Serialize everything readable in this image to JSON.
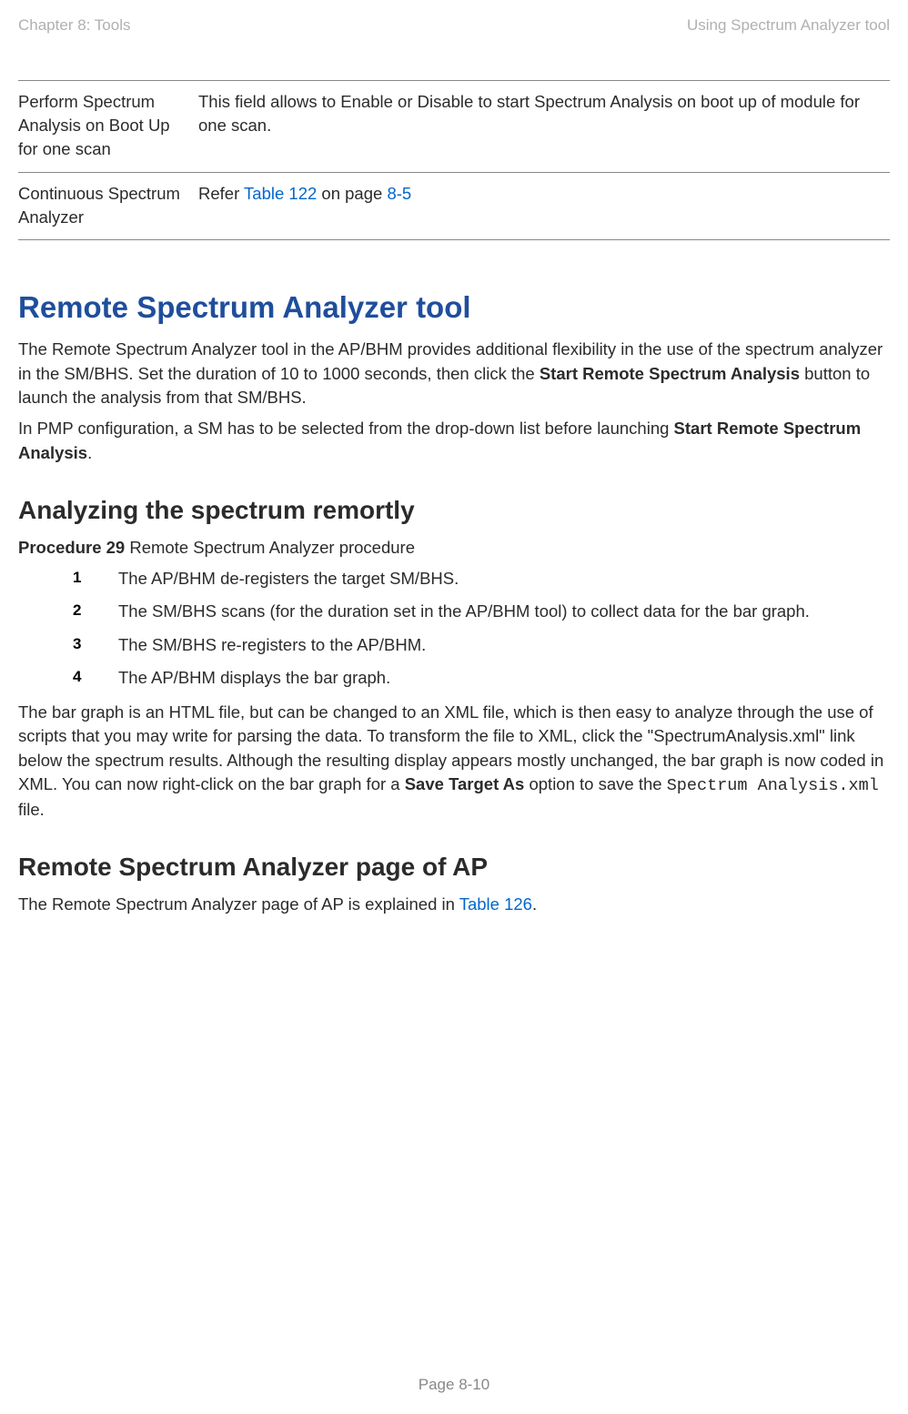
{
  "header": {
    "left": "Chapter 8:  Tools",
    "right": "Using Spectrum Analyzer tool"
  },
  "table": {
    "row1": {
      "left": "Perform Spectrum Analysis on Boot Up for one scan",
      "right": "This field allows to Enable or Disable to start Spectrum Analysis on boot up of module for one scan."
    },
    "row2": {
      "left": "Continuous Spectrum Analyzer",
      "right_prefix": "Refer ",
      "link1": "Table 122",
      "mid": " on page ",
      "link2": "8-5"
    }
  },
  "h1": "Remote Spectrum Analyzer tool",
  "para1_a": "The Remote Spectrum Analyzer tool in the AP/BHM provides additional flexibility in the use of the spectrum analyzer in the SM/BHS. Set the duration of 10 to 1000 seconds, then click the ",
  "para1_b": "Start Remote Spectrum Analysis",
  "para1_c": " button to launch the analysis from that SM/BHS.",
  "para2_a": "In PMP configuration, a SM has to be selected from the drop-down list before launching ",
  "para2_b": "Start Remote Spectrum Analysis",
  "para2_c": ".",
  "h2a": "Analyzing the spectrum remortly",
  "proc_label_a": "Procedure 29",
  "proc_label_b": "  Remote Spectrum Analyzer procedure",
  "steps": {
    "s1": "The AP/BHM de-registers the target SM/BHS.",
    "s2": "The SM/BHS scans (for the duration set in the AP/BHM tool) to collect data for the bar graph.",
    "s3": "The SM/BHS re-registers to the AP/BHM.",
    "s4": "The AP/BHM displays the bar graph."
  },
  "para3_a": "The bar graph is an HTML file, but can be changed to an XML file, which is then easy to analyze through the use of scripts that you may write for parsing the data. To transform the file to XML, click the \"SpectrumAnalysis.xml\" link below the spectrum results. Although the resulting display appears mostly unchanged, the bar graph is now coded in XML. You can now right-click on the bar graph for a ",
  "para3_b": "Save Target As",
  "para3_c": " option to save the ",
  "para3_mono": "Spectrum Analysis.xml",
  "para3_d": " file.",
  "h2b": "Remote Spectrum Analyzer page of AP",
  "para4_a": "The Remote Spectrum Analyzer page of AP is explained in ",
  "para4_link": "Table 126",
  "para4_b": ".",
  "footer": "Page 8-10"
}
